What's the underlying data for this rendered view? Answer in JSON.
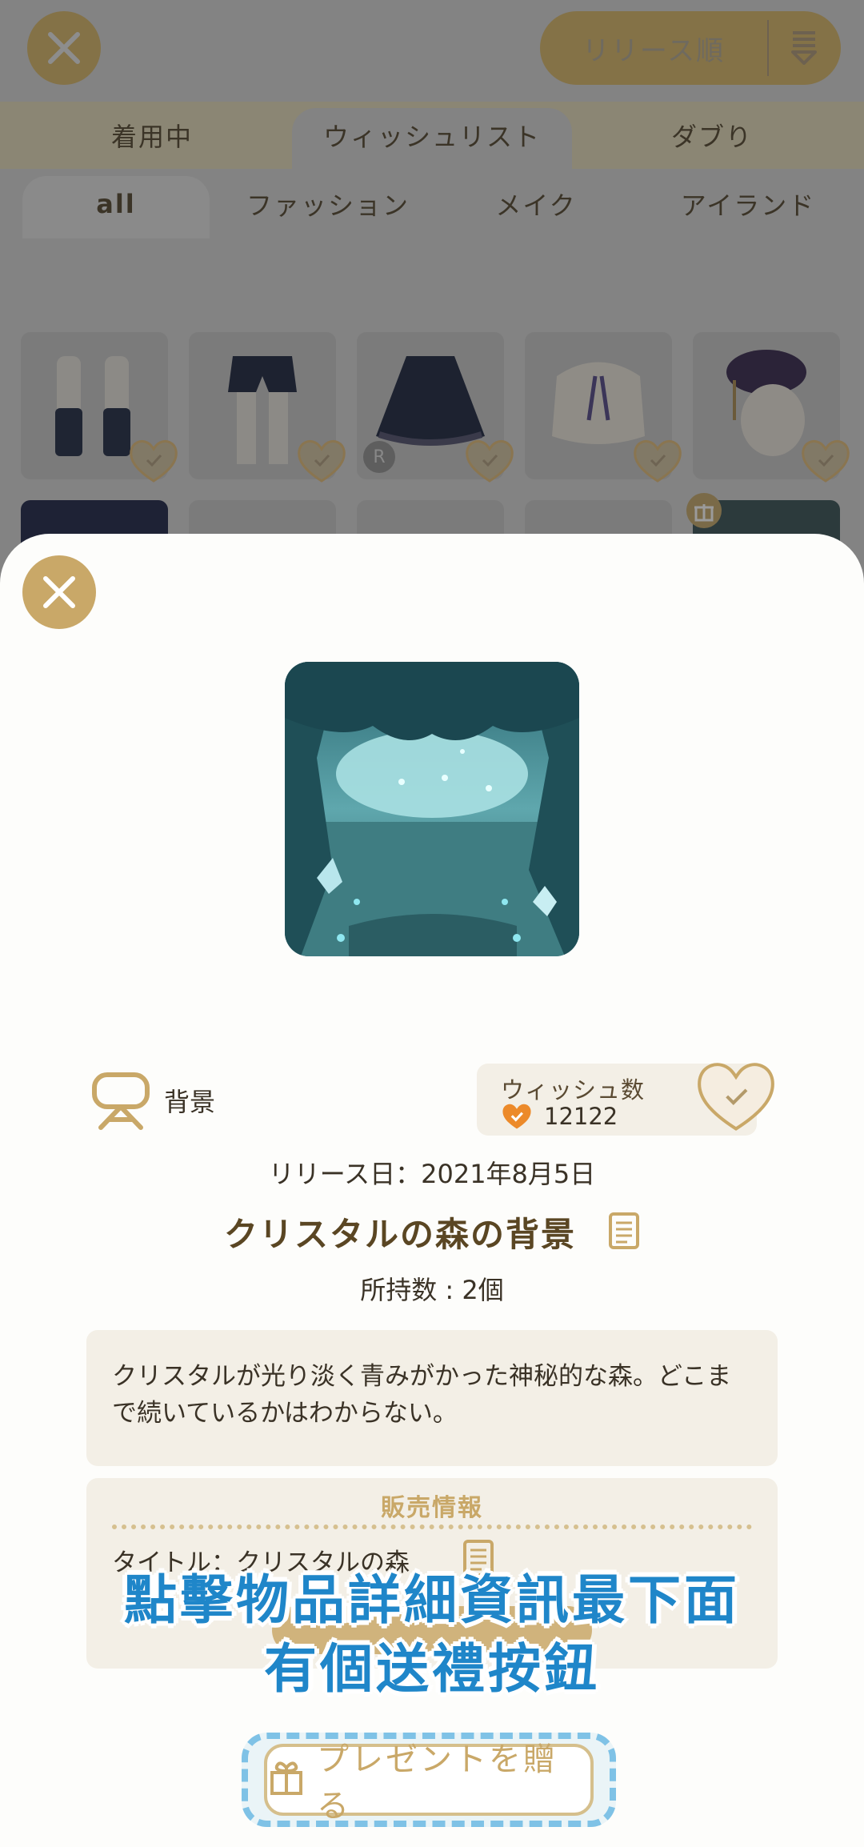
{
  "header": {
    "sort_label": "リリース順"
  },
  "tabs": [
    "着用中",
    "ウィッシュリスト",
    "ダブり"
  ],
  "categories": [
    "all",
    "ファッション",
    "メイク",
    "アイランド"
  ],
  "grid": {
    "rarity_badge": "R"
  },
  "detail": {
    "category": "背景",
    "wish_title": "ウィッシュ数",
    "wish_count": "12122",
    "release_date": "リリース日：2021年8月5日",
    "item_title": "クリスタルの森の背景",
    "owned": "所持数 : 2個",
    "description": "クリスタルが光り淡く青みがかった神秘的な森。どこまで続いているかはわからない。",
    "sale_header": "販売情報",
    "sale_title": "タイトル：クリスタルの森",
    "gift_button": "プレゼントを贈る"
  },
  "caption": {
    "line1": "點擊物品詳細資訊最下面",
    "line2": "有個送禮按鈕"
  },
  "colors": {
    "accent_gold": "#c9a868",
    "caption_blue": "#1f86c9",
    "highlight_outline": "#7fc2e6"
  }
}
